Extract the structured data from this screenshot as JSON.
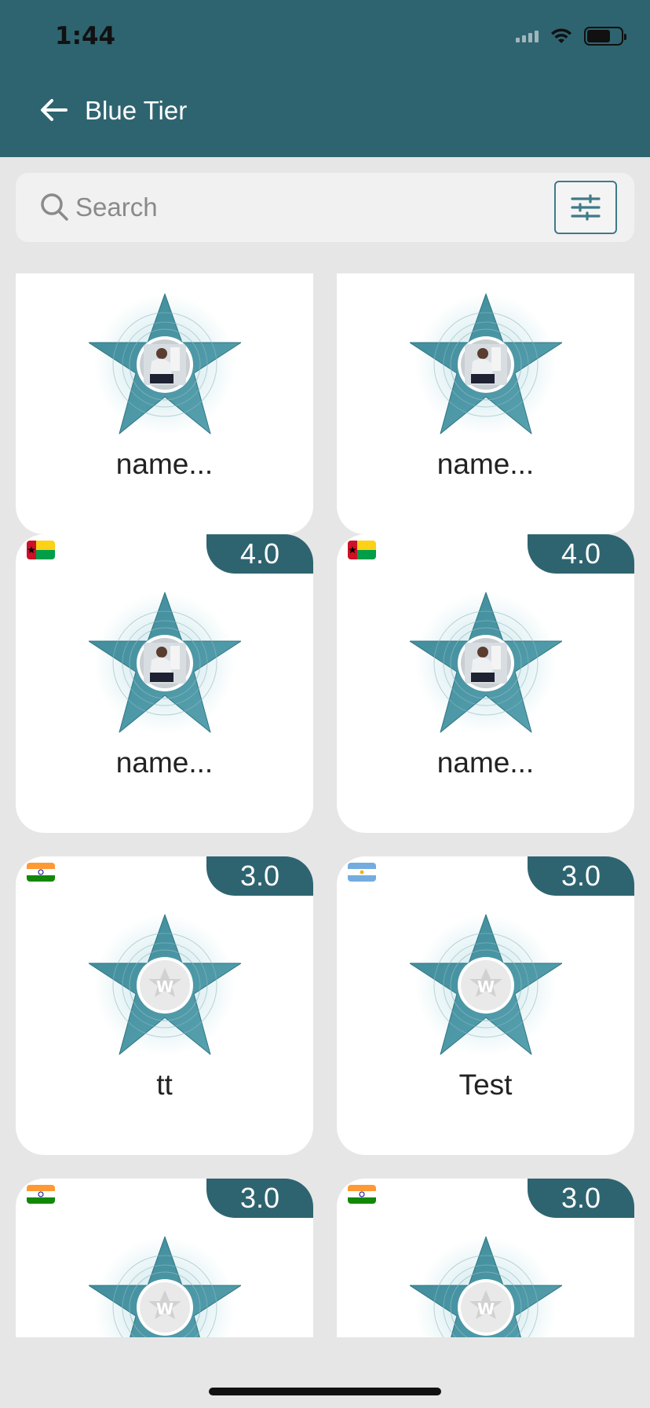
{
  "status_bar": {
    "time": "1:44"
  },
  "header": {
    "title": "Blue Tier",
    "back_icon": "arrow-left-icon"
  },
  "search": {
    "placeholder": "Search",
    "value": "",
    "filter_icon": "sliders-icon"
  },
  "colors": {
    "header_bg": "#2e6470",
    "star": "#4a95a4",
    "badge_bg": "#2e6470"
  },
  "cards": [
    {
      "name": "name...",
      "rating": "",
      "flag": "",
      "avatar": "photo"
    },
    {
      "name": "name...",
      "rating": "",
      "flag": "",
      "avatar": "photo"
    },
    {
      "name": "name...",
      "rating": "4.0",
      "flag": "guinea-bissau",
      "avatar": "photo"
    },
    {
      "name": "name...",
      "rating": "4.0",
      "flag": "guinea-bissau",
      "avatar": "photo"
    },
    {
      "name": "tt",
      "rating": "3.0",
      "flag": "india",
      "avatar": "placeholder-logo"
    },
    {
      "name": "Test",
      "rating": "3.0",
      "flag": "argentina",
      "avatar": "placeholder-logo"
    },
    {
      "name": "",
      "rating": "3.0",
      "flag": "india",
      "avatar": "placeholder-logo"
    },
    {
      "name": "",
      "rating": "3.0",
      "flag": "india",
      "avatar": "placeholder-logo"
    }
  ]
}
